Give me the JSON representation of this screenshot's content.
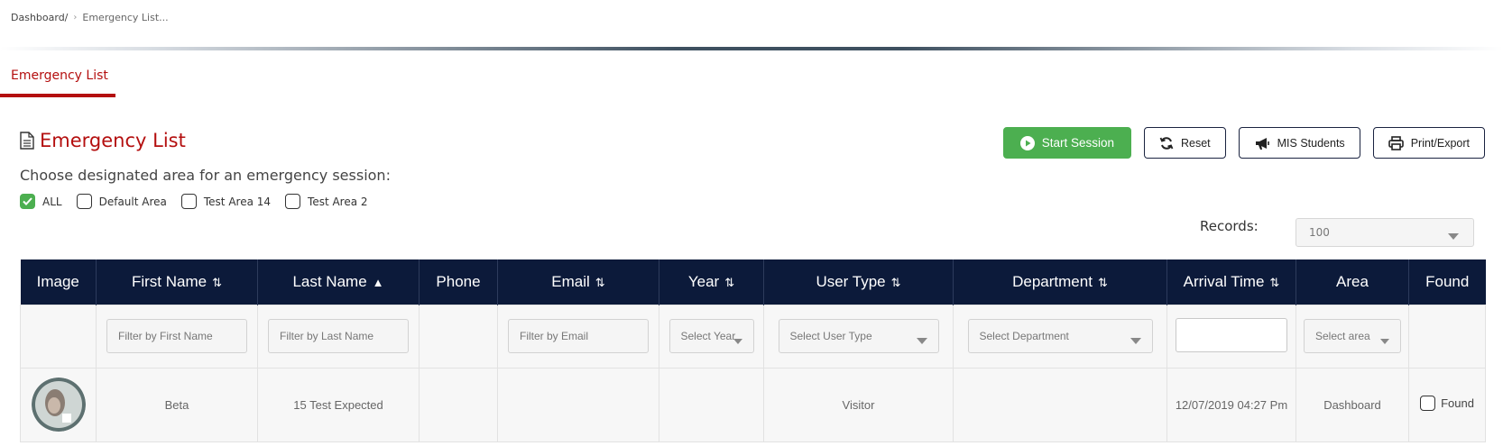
{
  "breadcrumb": {
    "home": "Dashboard/",
    "separator": "›",
    "current": "Emergency List..."
  },
  "tab": {
    "label": "Emergency List"
  },
  "page": {
    "title": "Emergency List",
    "subtitle": "Choose designated area for an emergency session:"
  },
  "areas": [
    {
      "label": "ALL",
      "checked": true
    },
    {
      "label": "Default Area",
      "checked": false
    },
    {
      "label": "Test Area 14",
      "checked": false
    },
    {
      "label": "Test Area 2",
      "checked": false
    }
  ],
  "actions": {
    "start_session": "Start Session",
    "reset": "Reset",
    "mis_students": "MIS Students",
    "print_export": "Print/Export"
  },
  "records": {
    "label": "Records:",
    "value": "100"
  },
  "table": {
    "headers": {
      "image": "Image",
      "first_name": "First Name",
      "last_name": "Last Name",
      "phone": "Phone",
      "email": "Email",
      "year": "Year",
      "user_type": "User Type",
      "department": "Department",
      "arrival_time": "Arrival Time",
      "area": "Area",
      "found": "Found"
    },
    "sort_icons": {
      "updown": "⇅",
      "up": "▲"
    },
    "filters": {
      "first_name": "Filter by First Name",
      "last_name": "Filter by Last Name",
      "email": "Filter by Email",
      "year": "Select Year",
      "user_type": "Select User Type",
      "department": "Select Department",
      "area": "Select area"
    },
    "rows": [
      {
        "first_name": "Beta",
        "last_name": "15 Test Expected",
        "phone": "",
        "email": "",
        "year": "",
        "user_type": "Visitor",
        "department": "",
        "arrival_time": "12/07/2019 04:27 Pm",
        "area": "Dashboard",
        "found_label": "Found"
      }
    ]
  },
  "colors": {
    "accent": "#b40f0f",
    "header_bg": "#0c1a3a",
    "success": "#4caf50"
  }
}
